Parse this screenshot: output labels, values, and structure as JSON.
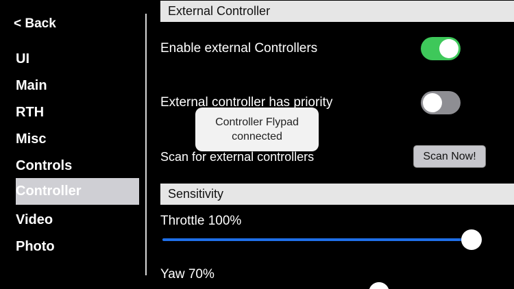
{
  "sidebar": {
    "back_label": "< Back",
    "items": [
      {
        "label": "UI",
        "selected": false
      },
      {
        "label": "Main",
        "selected": false
      },
      {
        "label": "RTH",
        "selected": false
      },
      {
        "label": "Misc",
        "selected": false
      },
      {
        "label": "Controls",
        "selected": false
      },
      {
        "label": "Controller",
        "selected": true
      },
      {
        "label": "Video",
        "selected": false
      },
      {
        "label": "Photo",
        "selected": false
      }
    ]
  },
  "external_controller": {
    "header": "External Controller",
    "enable_label": "Enable external Controllers",
    "enable_on": true,
    "priority_label": "External controller has priority",
    "priority_on": false,
    "scan_label": "Scan for external controllers",
    "scan_button": "Scan Now!"
  },
  "sensitivity": {
    "header": "Sensitivity",
    "throttle_label": "Throttle 100%",
    "throttle_value": 100,
    "yaw_label": "Yaw 70%",
    "yaw_value": 70
  },
  "toast": {
    "line1": "Controller Flypad",
    "line2": "connected"
  },
  "colors": {
    "toggle_on": "#3ec85a",
    "toggle_off": "#8e8e93",
    "slider": "#1f6fe8",
    "selected_nav": "#cfcfd4"
  }
}
